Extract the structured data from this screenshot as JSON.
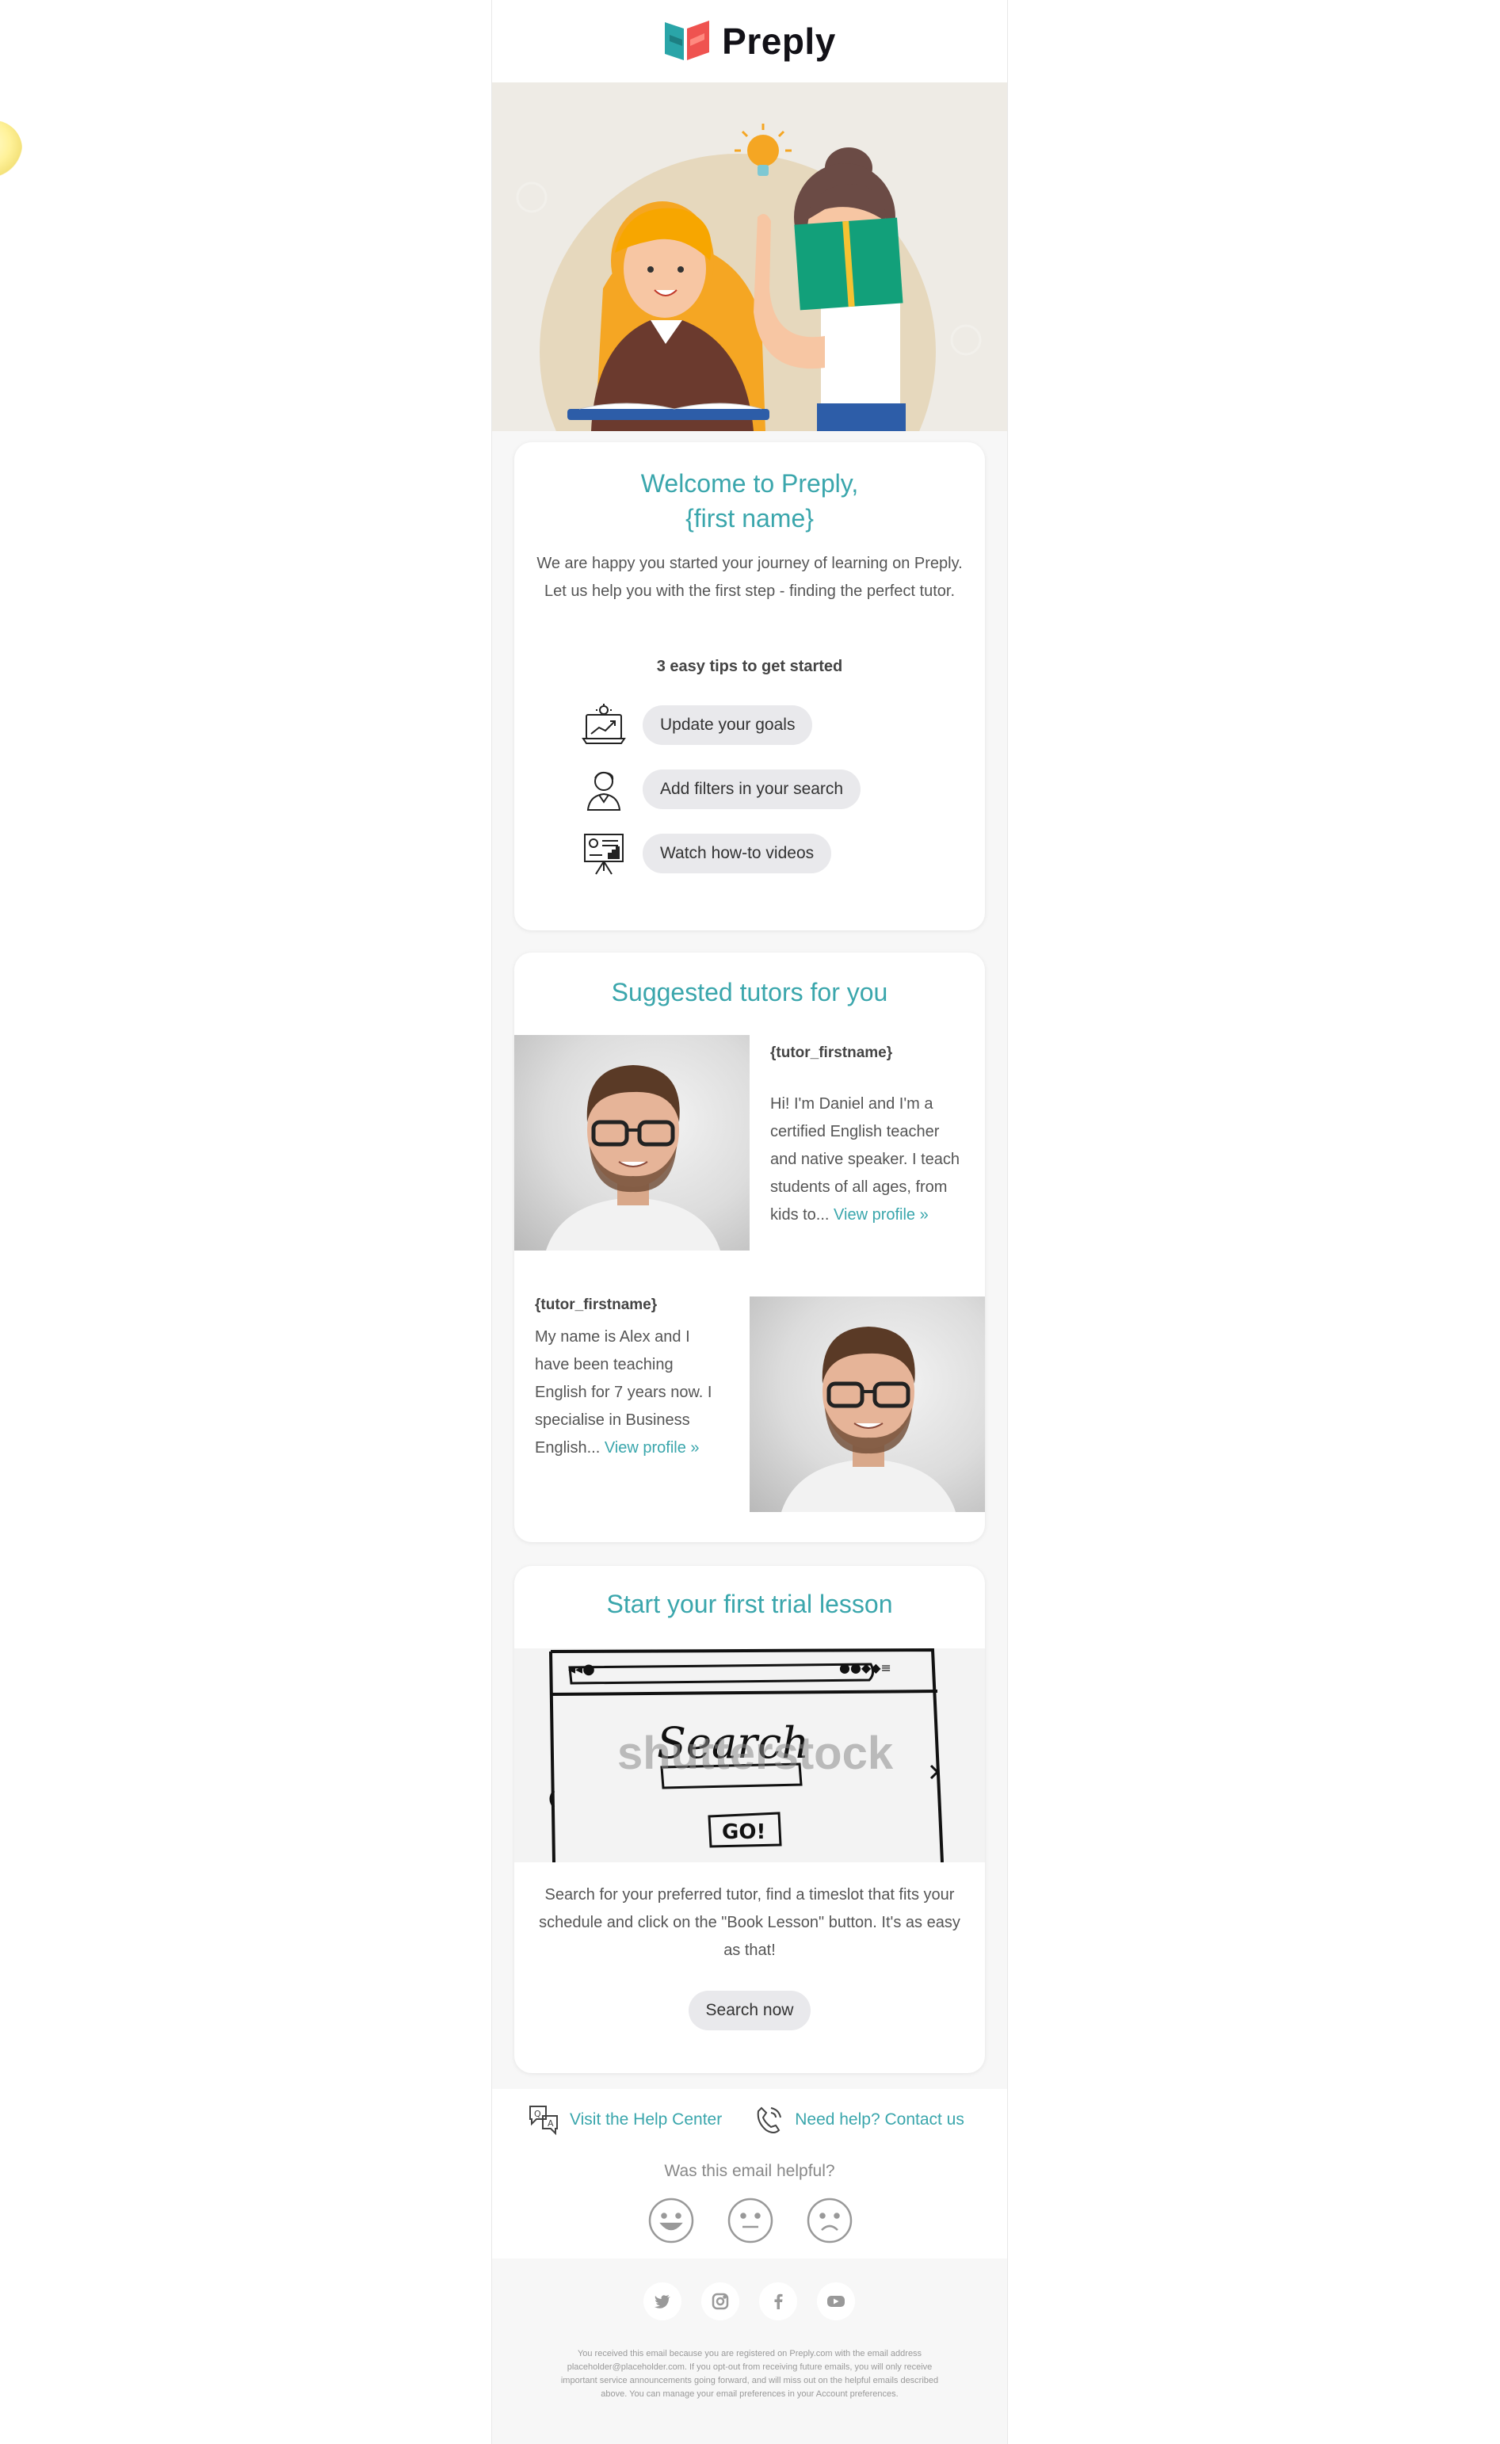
{
  "header": {
    "logo_text": "Preply"
  },
  "welcome": {
    "title_line1": "Welcome to Preply,",
    "title_line2": "{first name}",
    "intro_line1": "We are happy you started your journey of learning on Preply.",
    "intro_line2": "Let us help you with the first step - finding the perfect tutor.",
    "tips_heading": "3 easy tips to get started",
    "tips": [
      {
        "label": "Update your goals",
        "icon": "laptop-growth-icon"
      },
      {
        "label": "Add filters in your search",
        "icon": "person-tutor-icon"
      },
      {
        "label": "Watch how-to videos",
        "icon": "presentation-board-icon"
      }
    ]
  },
  "tutors": {
    "title": "Suggested tutors for you",
    "items": [
      {
        "name": "{tutor_firstname}",
        "lines": [
          "Hi! I'm Daniel and I'm a",
          "certified English teacher",
          "and native speaker. I teach",
          "students of all ages, from"
        ],
        "last_line": "kids to... ",
        "link": "View profile »"
      },
      {
        "name": "{tutor_firstname}",
        "lines": [
          "My name is Alex and I",
          "have been teaching",
          "English for 7 years now. I",
          "specialise in Business"
        ],
        "last_line": "English... ",
        "link": "View profile »"
      }
    ]
  },
  "trial": {
    "title": "Start your first trial lesson",
    "sketch": {
      "search_word": "Search",
      "go_label": "GO!",
      "watermark": "shutterstock"
    },
    "text_line1": "Search for your preferred tutor, find a timeslot that fits your",
    "text_line2": "schedule and click on the \"Book Lesson\" button. It's as easy",
    "text_line3": "as that!",
    "button": "Search now"
  },
  "help": {
    "help_center": "Visit the Help Center",
    "contact": "Need help? Contact us",
    "feedback_question": "Was this email helpful?",
    "feedback_icons": [
      "smiley-happy-icon",
      "smiley-neutral-icon",
      "smiley-sad-icon"
    ]
  },
  "social": [
    "twitter-icon",
    "instagram-icon",
    "facebook-icon",
    "youtube-icon"
  ],
  "legal": {
    "line1": "You received this email because you are registered on Preply.com with the email address",
    "line2": "placeholder@placeholder.com. If you opt-out from receiving future emails, you will only receive",
    "line3": "important service announcements going forward, and will miss out on the helpful emails described",
    "line4": "above. You can manage your email preferences in your Account preferences."
  },
  "colors": {
    "accent": "#3aa6ac",
    "pill": "#e9e9ec",
    "background": "#f7f7f7"
  }
}
